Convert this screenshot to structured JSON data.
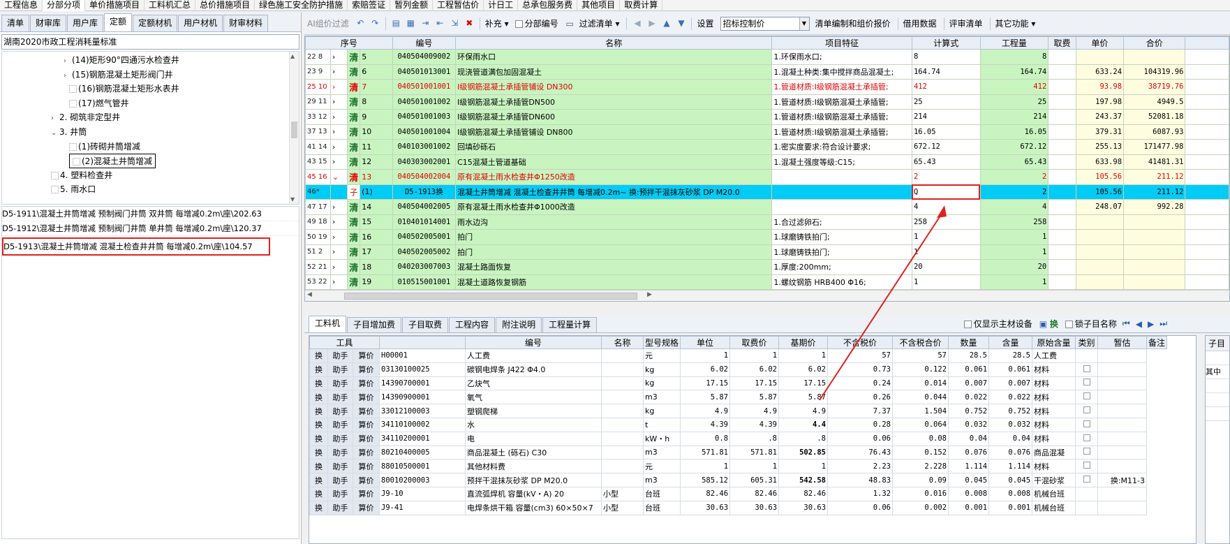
{
  "top_menu": [
    "工程信息",
    "分部分项",
    "单价措施项目",
    "工料机汇总",
    "总价措施项目",
    "绿色施工安全防护措施",
    "索赔签证",
    "暂列金额",
    "工程暂估价",
    "计日工",
    "总承包服务费",
    "其他项目",
    "取费计算"
  ],
  "top_menu_active": "分部分项",
  "left_tabs": [
    "清单",
    "财审库",
    "用户库",
    "定额",
    "定额材机",
    "用户材机",
    "财审材料"
  ],
  "left_tab_active": "定额",
  "standard": "湖南2020市政工程消耗量标准",
  "tree_items": [
    {
      "label": "(14)矩形90°四通污水检查井",
      "arrow": ">"
    },
    {
      "label": "(15)钢筋混凝土矩形阀门井",
      "arrow": ">"
    },
    {
      "label": "(16)钢筋混凝土矩形水表井",
      "arrow": ""
    },
    {
      "label": "(17)燃气管井",
      "arrow": ""
    },
    {
      "label": "2. 砌筑非定型井",
      "arrow": ">"
    },
    {
      "label": "3. 井筒",
      "arrow": "v"
    },
    {
      "label": "(1)砖砌井筒增减",
      "arrow": ""
    },
    {
      "label": "(2)混凝土井筒增减",
      "arrow": ""
    },
    {
      "label": "4. 塑料检查井",
      "arrow": ""
    },
    {
      "label": "5. 雨水口",
      "arrow": ""
    }
  ],
  "ref_items": [
    "D5-1911\\混凝土井筒增减 预制阀门井筒 双井筒 每增减0.2m\\座\\202.63",
    "D5-1912\\混凝土井筒增减 预制阀门井筒 单井筒 每增减0.2m\\座\\120.37",
    "D5-1913\\混凝土井筒增减 混凝土检查井井筒 每增减0.2m\\座\\104.57"
  ],
  "toolbar": {
    "ai": "AI组价过滤",
    "bucha": "补充",
    "fenbu": "分部编号",
    "filter": "过滤清单",
    "settings": "设置",
    "combo": "招标控制价",
    "bianzhi": "清单编制和组价报价",
    "jieyong": "借用数据",
    "pingshen": "评审清单",
    "other": "其它功能"
  },
  "main_headers": [
    "序号",
    "编号",
    "名称",
    "项目特征",
    "计算式",
    "工程量",
    "取费",
    "单价",
    "合价"
  ],
  "main_rows": [
    {
      "seq": "22 8",
      "tag": "清",
      "idx": "5",
      "code": "040504009002",
      "name": "环保雨水口",
      "feat": "1.环保雨水口;",
      "formula": "8",
      "qty": "8",
      "price": "",
      "total": "",
      "type": "g"
    },
    {
      "seq": "23 9",
      "tag": "清",
      "idx": "6",
      "code": "040501013001",
      "name": "现浇管道满包加固混凝土",
      "feat": "1.混凝土种类:集中搅拌商品混凝土;",
      "formula": "164.74",
      "qty": "164.74",
      "price": "633.24",
      "total": "104319.96",
      "type": "g"
    },
    {
      "seq": "25 10",
      "tag": "清",
      "idx": "7",
      "code": "040501001001",
      "name": "Ⅰ级钢筋混凝土承插管铺设 DN300",
      "feat": "1.管道材质:Ⅰ级钢筋混凝土承插管;",
      "formula": "412",
      "qty": "412",
      "price": "93.98",
      "total": "38719.76",
      "type": "gr"
    },
    {
      "seq": "29 11",
      "tag": "清",
      "idx": "8",
      "code": "040501001002",
      "name": "Ⅰ级钢筋混凝土承插管DN500",
      "feat": "1.管道材质:Ⅰ级钢筋混凝土承插管;",
      "formula": "25",
      "qty": "25",
      "price": "197.98",
      "total": "4949.5",
      "type": "g"
    },
    {
      "seq": "33 12",
      "tag": "清",
      "idx": "9",
      "code": "040501001003",
      "name": "Ⅰ级钢筋混凝土承插管DN600",
      "feat": "1.管道材质:Ⅰ级钢筋混凝土承插管;",
      "formula": "214",
      "qty": "214",
      "price": "243.37",
      "total": "52081.18",
      "type": "g"
    },
    {
      "seq": "37 13",
      "tag": "清",
      "idx": "10",
      "code": "040501001004",
      "name": "Ⅰ级钢筋混凝土承插管铺设 DN800",
      "feat": "1.管道材质:Ⅰ级钢筋混凝土承插管;",
      "formula": "16.05",
      "qty": "16.05",
      "price": "379.31",
      "total": "6087.93",
      "type": "g"
    },
    {
      "seq": "41 14",
      "tag": "清",
      "idx": "11",
      "code": "040103001002",
      "name": "回填砂砾石",
      "feat": "1.密实度要求:符合设计要求;",
      "formula": "672.12",
      "qty": "672.12",
      "price": "255.13",
      "total": "171477.98",
      "type": "g"
    },
    {
      "seq": "43 15",
      "tag": "清",
      "idx": "12",
      "code": "040303002001",
      "name": "C15混凝土管道基础",
      "feat": "1.混凝土强度等级:C15;",
      "formula": "65.43",
      "qty": "65.43",
      "price": "633.98",
      "total": "41481.31",
      "type": "g"
    },
    {
      "seq": "45 16",
      "tag": "清",
      "idx": "13",
      "code": "040504002004",
      "name": "原有混凝土雨水检查井Φ1250改造",
      "feat": "",
      "formula": "2",
      "qty": "2",
      "price": "105.56",
      "total": "211.12",
      "type": "gr"
    },
    {
      "seq": "46*",
      "tag": "子",
      "idx": "(1)",
      "code": "D5-1913换",
      "name": "混凝土井筒增减 混凝土检查井井筒  每增减0.2m~ 换:预拌干混抹灰砂浆 DP M20.0",
      "feat": "",
      "formula": "Q",
      "qty": "2",
      "price": "105.56",
      "total": "211.12",
      "type": "sel"
    },
    {
      "seq": "47 17",
      "tag": "清",
      "idx": "14",
      "code": "040504002005",
      "name": "原有混凝土雨水检查井Φ1000改造",
      "feat": "",
      "formula": "4",
      "qty": "4",
      "price": "248.07",
      "total": "992.28",
      "type": "g"
    },
    {
      "seq": "49 18",
      "tag": "清",
      "idx": "15",
      "code": "010401014001",
      "name": "雨水边沟",
      "feat": "1.合过滤卵石;",
      "formula": "258",
      "qty": "258",
      "price": "",
      "total": "",
      "type": "g"
    },
    {
      "seq": "50 19",
      "tag": "清",
      "idx": "16",
      "code": "040502005001",
      "name": "拍门",
      "feat": "1.球磨铸铁拍门;",
      "formula": "1",
      "qty": "1",
      "price": "",
      "total": "",
      "type": "g"
    },
    {
      "seq": "51 2",
      "tag": "清",
      "idx": "17",
      "code": "040502005002",
      "name": "拍门",
      "feat": "1.球磨铸铁拍门;",
      "formula": "1",
      "qty": "1",
      "price": "",
      "total": "",
      "type": "g"
    },
    {
      "seq": "52 21",
      "tag": "清",
      "idx": "18",
      "code": "040203007003",
      "name": "混凝土路面恢复",
      "feat": "1.厚度:200mm;",
      "formula": "20",
      "qty": "20",
      "price": "",
      "total": "",
      "type": "g"
    },
    {
      "seq": "53 22",
      "tag": "清",
      "idx": "19",
      "code": "010515001001",
      "name": "混凝土道路恢复钢筋",
      "feat": "1.螺纹钢筋 HRB400 Φ16;",
      "formula": "1",
      "qty": "1",
      "price": "",
      "total": "",
      "type": "g"
    }
  ],
  "bottom_tabs": [
    "工料机",
    "子目增加费",
    "子目取费",
    "工程内容",
    "附注说明",
    "工程量计算"
  ],
  "bottom_tab_active": "工料机",
  "bottom_options": {
    "only_main": "仅显示主材设备",
    "swap": "换",
    "lock_name": "锁子目名称"
  },
  "detail_headers": [
    "工具",
    "编号",
    "名称",
    "型号规格",
    "单位",
    "取费价",
    "基期价",
    "不含税价",
    "不含税合价",
    "数量",
    "含量",
    "原始含量",
    "类别",
    "暂估",
    "备注"
  ],
  "detail_buttons": [
    "换",
    "助手",
    "算价"
  ],
  "detail_rows": [
    {
      "code": "H00001",
      "name": "人工费",
      "spec": "",
      "unit": "元",
      "qp": "1",
      "jq": "1",
      "bhs": "1",
      "bhshj": "57",
      "sl": "57",
      "hl": "28.5",
      "yshl": "28.5",
      "lb": "人工费",
      "bz": "",
      "bold": false,
      "cb": false
    },
    {
      "code": "03130100025",
      "name": "碳钢电焊条 J422 Φ4.0",
      "spec": "",
      "unit": "kg",
      "qp": "6.02",
      "jq": "6.02",
      "bhs": "6.02",
      "bhshj": "0.73",
      "sl": "0.122",
      "hl": "0.061",
      "yshl": "0.061",
      "lb": "材料",
      "bz": "",
      "bold": false,
      "cb": true
    },
    {
      "code": "14390700001",
      "name": "乙炔气",
      "spec": "",
      "unit": "kg",
      "qp": "17.15",
      "jq": "17.15",
      "bhs": "17.15",
      "bhshj": "0.24",
      "sl": "0.014",
      "hl": "0.007",
      "yshl": "0.007",
      "lb": "材料",
      "bz": "",
      "bold": false,
      "cb": true
    },
    {
      "code": "14390900001",
      "name": "氧气",
      "spec": "",
      "unit": "m3",
      "qp": "5.87",
      "jq": "5.87",
      "bhs": "5.87",
      "bhshj": "0.26",
      "sl": "0.044",
      "hl": "0.022",
      "yshl": "0.022",
      "lb": "材料",
      "bz": "",
      "bold": false,
      "cb": true
    },
    {
      "code": "33012100003",
      "name": "塑钢爬梯",
      "spec": "",
      "unit": "kg",
      "qp": "4.9",
      "jq": "4.9",
      "bhs": "4.9",
      "bhshj": "7.37",
      "sl": "1.504",
      "hl": "0.752",
      "yshl": "0.752",
      "lb": "材料",
      "bz": "",
      "bold": false,
      "cb": true
    },
    {
      "code": "34110100002",
      "name": "水",
      "spec": "",
      "unit": "t",
      "qp": "4.39",
      "jq": "4.39",
      "bhs": "4.4",
      "bhshj": "0.28",
      "sl": "0.064",
      "hl": "0.032",
      "yshl": "0.032",
      "lb": "材料",
      "bz": "",
      "bold": true,
      "cb": true
    },
    {
      "code": "34110200001",
      "name": "电",
      "spec": "",
      "unit": "kW・h",
      "qp": "0.8",
      "jq": ".8",
      "bhs": ".8",
      "bhshj": "0.06",
      "sl": "0.08",
      "hl": "0.04",
      "yshl": "0.04",
      "lb": "材料",
      "bz": "",
      "bold": false,
      "cb": true
    },
    {
      "code": "80210400005",
      "name": "商品混凝土 (砾石) C30",
      "spec": "",
      "unit": "m3",
      "qp": "571.81",
      "jq": "571.81",
      "bhs": "502.85",
      "bhshj": "76.43",
      "sl": "0.152",
      "hl": "0.076",
      "yshl": "0.076",
      "lb": "商品混凝",
      "bz": "",
      "bold": true,
      "cb": true
    },
    {
      "code": "88010500001",
      "name": "其他材料费",
      "spec": "",
      "unit": "元",
      "qp": "1",
      "jq": "1",
      "bhs": "1",
      "bhshj": "2.23",
      "sl": "2.228",
      "hl": "1.114",
      "yshl": "1.114",
      "lb": "材料",
      "bz": "",
      "bold": false,
      "cb": true
    },
    {
      "code": "80010200003",
      "name": "预拌干混抹灰砂浆 DP M20.0",
      "spec": "",
      "unit": "m3",
      "qp": "585.12",
      "jq": "605.31",
      "bhs": "542.58",
      "bhshj": "48.83",
      "sl": "0.09",
      "hl": "0.045",
      "yshl": "0.045",
      "lb": "干混砂浆",
      "bz": "换:M11-3",
      "bold": true,
      "cb": true
    },
    {
      "code": "J9-10",
      "name": "直流弧焊机 容量(kV・A) 20",
      "spec": "小型",
      "unit": "台班",
      "qp": "82.46",
      "jq": "82.46",
      "bhs": "82.46",
      "bhshj": "1.32",
      "sl": "0.016",
      "hl": "0.008",
      "yshl": "0.008",
      "lb": "机械台班",
      "bz": "",
      "bold": false,
      "cb": false
    },
    {
      "code": "J9-41",
      "name": "电焊条烘干箱 容量(cm3) 60×50×7",
      "spec": "小型",
      "unit": "台班",
      "qp": "30.63",
      "jq": "30.63",
      "bhs": "30.63",
      "bhshj": "0.06",
      "sl": "0.002",
      "hl": "0.001",
      "yshl": "0.001",
      "lb": "机械台班",
      "bz": "",
      "bold": false,
      "cb": false
    }
  ],
  "side_panel": {
    "tab": "子目",
    "cell": "其中"
  }
}
